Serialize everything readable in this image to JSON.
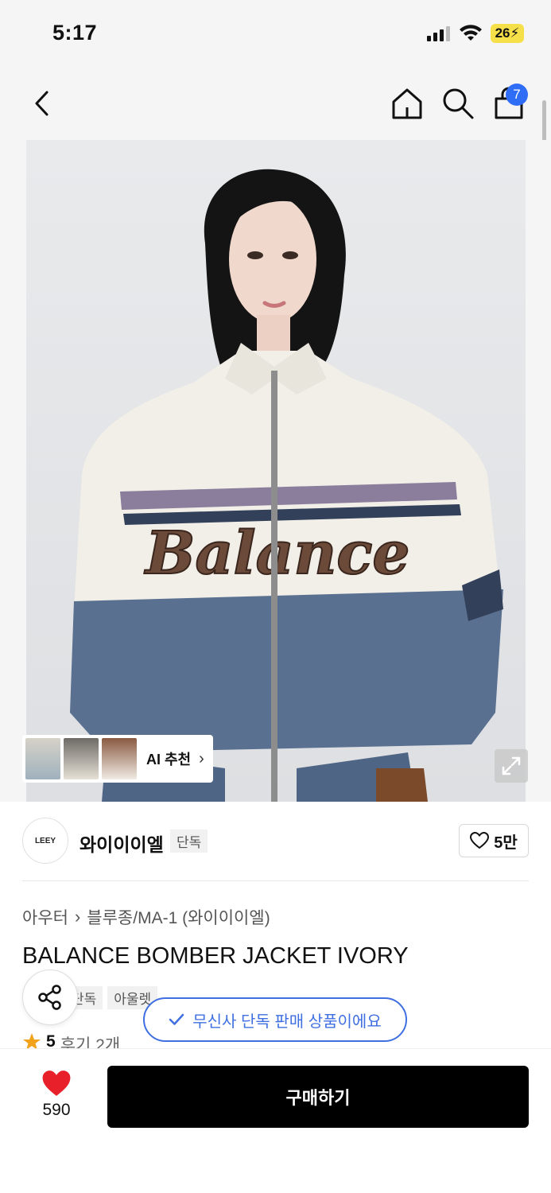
{
  "status_bar": {
    "time": "5:17",
    "battery": "26"
  },
  "nav": {
    "cart_count": "7"
  },
  "product_image": {
    "jacket_text": "Balance",
    "colors": {
      "ivory": "#f1efe8",
      "navy": "#5a7090",
      "brown_patch": "#6b4a3a",
      "stripe_purple": "#8b7d9c"
    }
  },
  "recommendation": {
    "label": "AI 추천"
  },
  "brand": {
    "logo_text": "LEEY",
    "name": "와이이이엘",
    "tag": "단독",
    "likes": "5만"
  },
  "breadcrumb": {
    "category": "아우터",
    "subcategory": "블루종/MA-1 (와이이이엘)"
  },
  "product": {
    "title": "BALANCE BOMBER JACKET IVORY",
    "tags": [
      "단독",
      "아울렛"
    ]
  },
  "notice": {
    "exclusive": "무신사 단독 판매 상품이에요"
  },
  "rating": {
    "score": "5",
    "reviews": "후기 2개"
  },
  "bottom": {
    "wish_count": "590",
    "buy_label": "구매하기"
  },
  "colors": {
    "accent_blue": "#3f6fe0",
    "badge_blue": "#2f6df6",
    "heart_red": "#e8202a",
    "star_orange": "#f2a21b"
  }
}
